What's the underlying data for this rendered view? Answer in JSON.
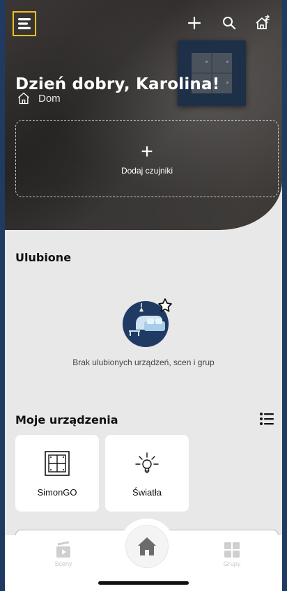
{
  "header": {
    "greeting": "Dzień dobry, Karolina!",
    "location": "Dom",
    "icons": [
      "menu-icon",
      "plus-icon",
      "search-icon",
      "home-switch-icon",
      "home-outline-icon"
    ]
  },
  "add_sensors": {
    "plus": "+",
    "label": "Dodaj czujniki"
  },
  "favorites": {
    "title": "Ulubione",
    "empty_text": "Brak ulubionych urządzeń, scen i grup"
  },
  "devices": {
    "title": "Moje urządzenia",
    "items": [
      {
        "label": "SimonGO",
        "icon": "switch-panel-icon"
      },
      {
        "label": "Światła",
        "icon": "lightbulb-icon"
      }
    ]
  },
  "bottom_nav": {
    "left_label": "Sceny",
    "right_label": "Grupy"
  },
  "colors": {
    "accent_highlight": "#f2c21b",
    "hero_dark": "#34312f",
    "navy": "#1f3b63",
    "background": "#e8e8e8"
  }
}
